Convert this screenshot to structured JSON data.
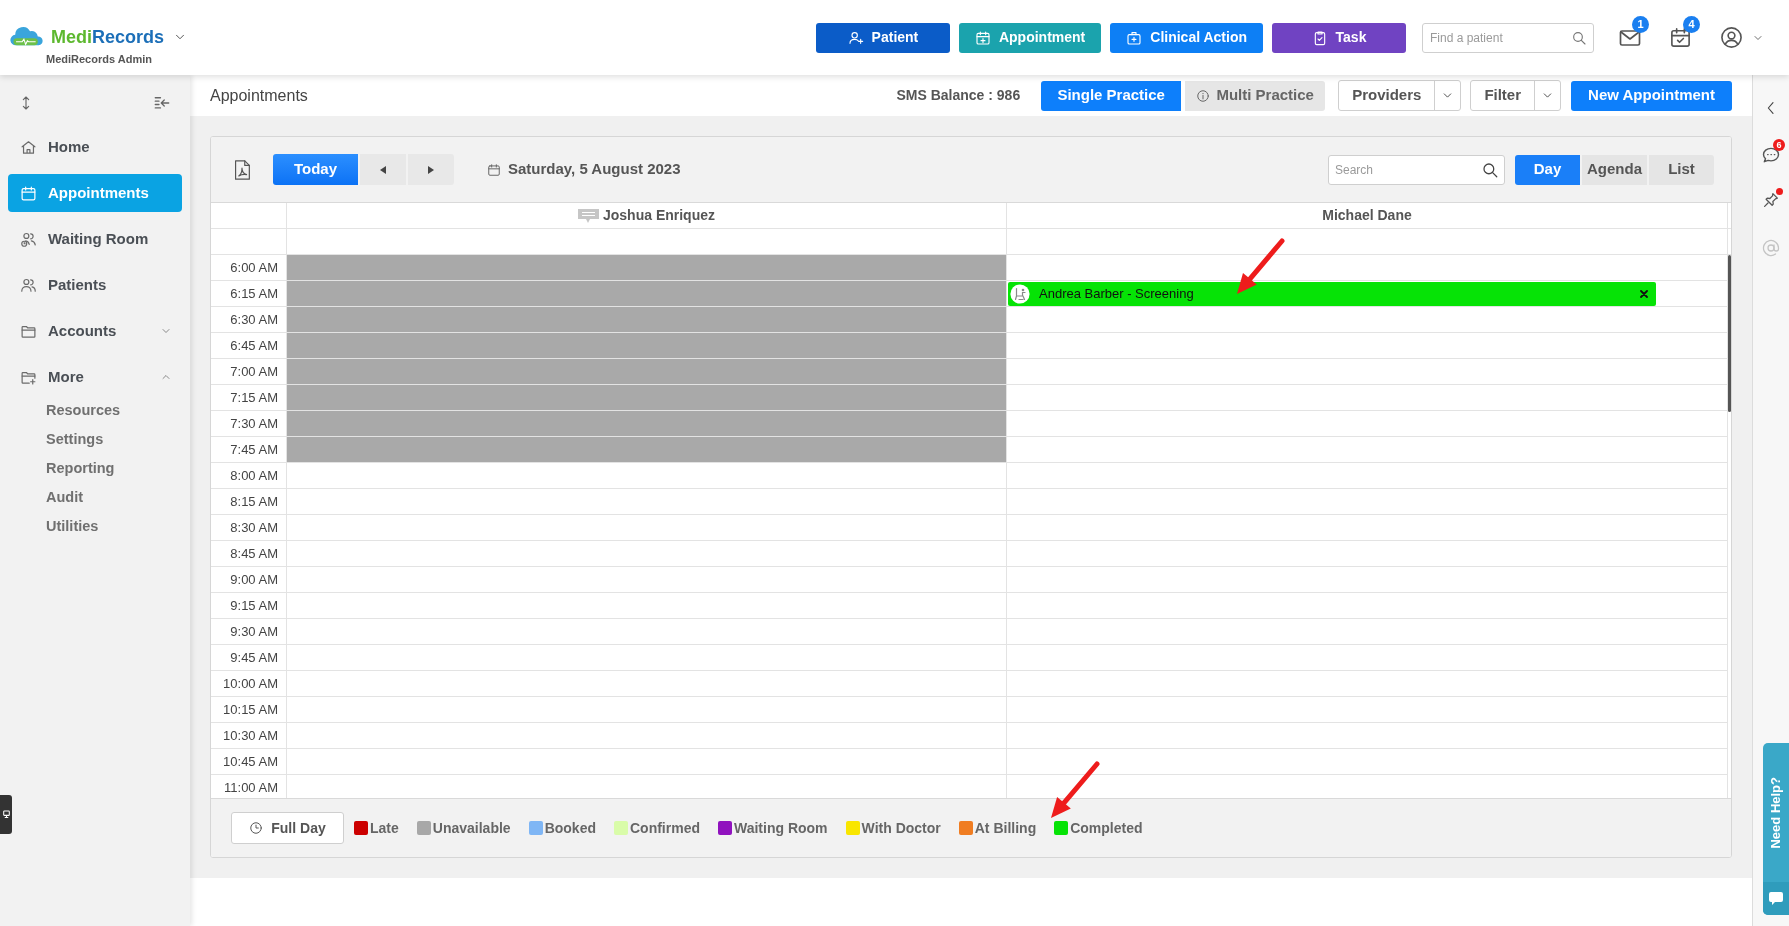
{
  "header": {
    "brand": {
      "name_parts": [
        "Medi",
        "Records"
      ],
      "subtitle": "MediRecords Admin"
    },
    "actions": [
      {
        "label": "Patient",
        "color": "#0b5cc8"
      },
      {
        "label": "Appointment",
        "color": "#1ba3ad"
      },
      {
        "label": "Clinical Action",
        "color": "#0d7ff5"
      },
      {
        "label": "Task",
        "color": "#7043c2"
      }
    ],
    "search": {
      "placeholder": "Find a patient"
    },
    "notifications": [
      {
        "count": "1"
      },
      {
        "count": "4"
      }
    ]
  },
  "sidebar": {
    "items": [
      {
        "label": "Home",
        "kind": "link",
        "selected": false
      },
      {
        "label": "Appointments",
        "kind": "link",
        "selected": true
      },
      {
        "label": "Waiting Room",
        "kind": "link",
        "selected": false
      },
      {
        "label": "Patients",
        "kind": "link",
        "selected": false
      },
      {
        "label": "Accounts",
        "kind": "group",
        "selected": false,
        "expanded": false
      },
      {
        "label": "More",
        "kind": "group",
        "selected": false,
        "expanded": true,
        "children": [
          {
            "label": "Resources",
            "selected": false
          },
          {
            "label": "Settings",
            "selected": false
          },
          {
            "label": "Reporting",
            "selected": false
          },
          {
            "label": "Audit",
            "selected": false
          },
          {
            "label": "Utilities",
            "selected": false
          }
        ]
      }
    ]
  },
  "page": {
    "title": "Appointments",
    "sms_balance": "SMS Balance : 986",
    "practice_modes": [
      {
        "label": "Single Practice",
        "selected": true
      },
      {
        "label": "Multi Practice",
        "selected": false
      }
    ],
    "dropdowns": [
      {
        "label": "Providers"
      },
      {
        "label": "Filter"
      }
    ],
    "new_button": "New Appointment"
  },
  "calendar": {
    "today_button": "Today",
    "date": "Saturday, 5 August 2023",
    "search": {
      "placeholder": "Search"
    },
    "views": [
      {
        "label": "Day",
        "selected": true
      },
      {
        "label": "Agenda",
        "selected": false
      },
      {
        "label": "List",
        "selected": false
      }
    ],
    "columns": [
      {
        "name": "Joshua Enriquez",
        "note": true
      },
      {
        "name": "Michael Dane",
        "note": false
      }
    ],
    "rows": [
      {
        "time": "6:00 AM",
        "cells": [
          {
            "unavailable": true
          },
          {
            "unavailable": false
          }
        ]
      },
      {
        "time": "6:15 AM",
        "cells": [
          {
            "unavailable": true
          },
          {
            "unavailable": false,
            "appointment": {
              "title": "Andrea Barber - Screening",
              "color": "#06e306"
            }
          }
        ]
      },
      {
        "time": "6:30 AM",
        "cells": [
          {
            "unavailable": true
          },
          {
            "unavailable": false
          }
        ]
      },
      {
        "time": "6:45 AM",
        "cells": [
          {
            "unavailable": true
          },
          {
            "unavailable": false
          }
        ]
      },
      {
        "time": "7:00 AM",
        "cells": [
          {
            "unavailable": true
          },
          {
            "unavailable": false
          }
        ]
      },
      {
        "time": "7:15 AM",
        "cells": [
          {
            "unavailable": true
          },
          {
            "unavailable": false
          }
        ]
      },
      {
        "time": "7:30 AM",
        "cells": [
          {
            "unavailable": true
          },
          {
            "unavailable": false
          }
        ]
      },
      {
        "time": "7:45 AM",
        "cells": [
          {
            "unavailable": true
          },
          {
            "unavailable": false
          }
        ]
      },
      {
        "time": "8:00 AM",
        "cells": [
          {
            "unavailable": false
          },
          {
            "unavailable": false
          }
        ]
      },
      {
        "time": "8:15 AM",
        "cells": [
          {
            "unavailable": false
          },
          {
            "unavailable": false
          }
        ]
      },
      {
        "time": "8:30 AM",
        "cells": [
          {
            "unavailable": false
          },
          {
            "unavailable": false
          }
        ]
      },
      {
        "time": "8:45 AM",
        "cells": [
          {
            "unavailable": false
          },
          {
            "unavailable": false
          }
        ]
      },
      {
        "time": "9:00 AM",
        "cells": [
          {
            "unavailable": false
          },
          {
            "unavailable": false
          }
        ]
      },
      {
        "time": "9:15 AM",
        "cells": [
          {
            "unavailable": false
          },
          {
            "unavailable": false
          }
        ]
      },
      {
        "time": "9:30 AM",
        "cells": [
          {
            "unavailable": false
          },
          {
            "unavailable": false
          }
        ]
      },
      {
        "time": "9:45 AM",
        "cells": [
          {
            "unavailable": false
          },
          {
            "unavailable": false
          }
        ]
      },
      {
        "time": "10:00 AM",
        "cells": [
          {
            "unavailable": false
          },
          {
            "unavailable": false
          }
        ]
      },
      {
        "time": "10:15 AM",
        "cells": [
          {
            "unavailable": false
          },
          {
            "unavailable": false
          }
        ]
      },
      {
        "time": "10:30 AM",
        "cells": [
          {
            "unavailable": false
          },
          {
            "unavailable": false
          }
        ]
      },
      {
        "time": "10:45 AM",
        "cells": [
          {
            "unavailable": false
          },
          {
            "unavailable": false
          }
        ]
      },
      {
        "time": "11:00 AM",
        "cells": [
          {
            "unavailable": false
          },
          {
            "unavailable": false
          }
        ]
      }
    ],
    "full_day_button": "Full Day",
    "legend": [
      {
        "label": "Late",
        "color": "#cc0000"
      },
      {
        "label": "Unavailable",
        "color": "#a8a8a8"
      },
      {
        "label": "Booked",
        "color": "#7fb6f5"
      },
      {
        "label": "Confirmed",
        "color": "#d9fca9"
      },
      {
        "label": "Waiting Room",
        "color": "#9012be"
      },
      {
        "label": "With Doctor",
        "color": "#f9e600"
      },
      {
        "label": "At Billing",
        "color": "#f07d22"
      },
      {
        "label": "Completed",
        "color": "#06e306"
      }
    ]
  },
  "right_rail": {
    "chat_count": "6",
    "pin_alert": true,
    "help_tab": "Need Help?"
  }
}
